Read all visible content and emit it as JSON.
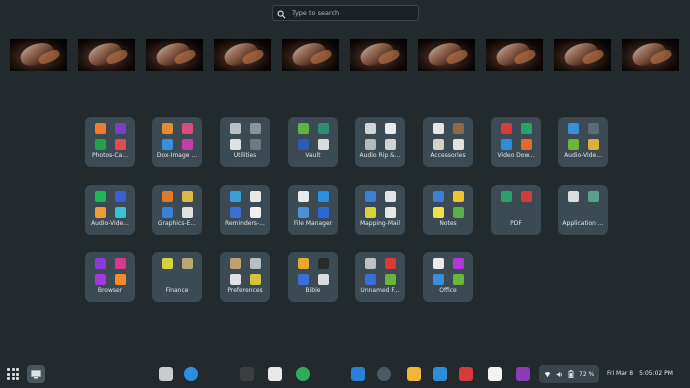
{
  "search": {
    "placeholder": "Type to search"
  },
  "workspaces": [
    "ws1",
    "ws2",
    "ws3",
    "ws4",
    "ws5",
    "ws6",
    "ws7",
    "ws8",
    "ws9",
    "ws10"
  ],
  "folders": [
    {
      "label": "Photos-Ca...",
      "icons": [
        "#f27b2c",
        "#7a3fc0",
        "#22a34a",
        "#e14d4d"
      ],
      "icon_names": [
        "photo-icon",
        "camera-icon",
        "gallery-icon",
        "image-viewer-icon"
      ]
    },
    {
      "label": "Dox-Image ...",
      "icons": [
        "#e58a32",
        "#d94d7c",
        "#3b8fd8",
        "#c53ea6"
      ],
      "icon_names": [
        "document-icon",
        "image-editor-icon",
        "scanner-icon",
        "viewer-icon"
      ]
    },
    {
      "label": "Utilities",
      "icons": [
        "#b9c0c4",
        "#8d9397",
        "#dfe3e6",
        "#6f7a80"
      ],
      "icon_names": [
        "monitor-icon",
        "disk-icon",
        "tool-icon",
        "terminal-icon"
      ]
    },
    {
      "label": "Vault",
      "icons": [
        "#5fb248",
        "#2f8f6f",
        "#2d5ab3",
        "#d8dcde"
      ],
      "icon_names": [
        "vault-icon",
        "lock-icon",
        "shield-icon",
        "key-icon"
      ]
    },
    {
      "label": "Audio Rip &...",
      "icons": [
        "#d1d5d8",
        "#e8eaeb",
        "#b3b9bc",
        "#cfd3d6"
      ],
      "icon_names": [
        "disc-icon",
        "cd-icon",
        "ripper-icon",
        "audio-icon"
      ]
    },
    {
      "label": "Accessories",
      "icons": [
        "#e6e6e6",
        "#8b6b4a",
        "#d6d0c6",
        "#e1e1e1"
      ],
      "icon_names": [
        "cup-icon",
        "coffee-icon",
        "notes-icon",
        "calc-icon"
      ]
    },
    {
      "label": "Video Dow...",
      "icons": [
        "#d93a3a",
        "#2aa36a",
        "#2a8fd6",
        "#e36a2a"
      ],
      "icon_names": [
        "video-download-icon",
        "tube-icon",
        "globe-icon",
        "down-icon"
      ]
    },
    {
      "label": "Audio-Vide...",
      "icons": [
        "#3a8fd8",
        "#5a6b74",
        "#6bb53a",
        "#d8b03a"
      ],
      "icon_names": [
        "player-icon",
        "camera-video-icon",
        "media-icon",
        "film-icon"
      ]
    },
    {
      "label": "Audio-Vide...",
      "icons": [
        "#1db954",
        "#3a5fd8",
        "#f29c38",
        "#3ac1d8"
      ],
      "icon_names": [
        "spotify-icon",
        "music-icon",
        "media-player-icon",
        "play-store-icon"
      ]
    },
    {
      "label": "Graphics-E...",
      "icons": [
        "#e07a2a",
        "#d8b94a",
        "#3a7fd8",
        "#e0e0e0"
      ],
      "icon_names": [
        "paint-icon",
        "draw-icon",
        "color-icon",
        "pen-icon"
      ]
    },
    {
      "label": "Reminders-...",
      "icons": [
        "#3a9fd8",
        "#e8e8e8",
        "#3a6fd8",
        "#f0f0f0"
      ],
      "icon_names": [
        "calendar-icon",
        "notes-icon",
        "clock-icon",
        "dot-icon"
      ]
    },
    {
      "label": "File Manager",
      "icons": [
        "#e8eaeb",
        "#2a8fe0",
        "#4a8fd8",
        "#2a6ad8"
      ],
      "icon_names": [
        "file-icon",
        "folder-icon",
        "drive-icon",
        "explorer-icon"
      ]
    },
    {
      "label": "Mapping-Mail",
      "icons": [
        "#3a7fd8",
        "#dfe3e6",
        "#d8d23a",
        "#e6e6e6"
      ],
      "icon_names": [
        "map-icon",
        "route-icon",
        "mail-icon",
        "pin-icon"
      ]
    },
    {
      "label": "Notes",
      "icons": [
        "#3a7fd8",
        "#f2c230",
        "#f2e04a",
        "#5ab048"
      ],
      "icon_names": [
        "notes-icon",
        "sticky-icon",
        "memo-icon",
        "list-icon"
      ]
    },
    {
      "label": "PDF",
      "icons": [
        "#2aa36a",
        "#d83a3a"
      ],
      "icon_names": [
        "pdf-viewer-icon",
        "pdf-icon"
      ]
    },
    {
      "label": "Application ...",
      "icons": [
        "#d9dde0",
        "#5aa08f"
      ],
      "icon_names": [
        "app-icon",
        "package-icon"
      ]
    },
    {
      "label": "Browser",
      "icons": [
        "#8b3ad8",
        "#d83a8b",
        "#a03ad8",
        "#f28c2a"
      ],
      "icon_names": [
        "tor-icon",
        "browser-icon",
        "vivaldi-icon",
        "firefox-icon"
      ]
    },
    {
      "label": "Finance",
      "icons": [
        "#d8d23a",
        "#b8a878"
      ],
      "icon_names": [
        "money-icon",
        "coins-icon"
      ]
    },
    {
      "label": "Preferences",
      "icons": [
        "#c0a070",
        "#b9bec1",
        "#dfe3e6",
        "#d8c23a"
      ],
      "icon_names": [
        "settings-icon",
        "config-icon",
        "tweaks-icon",
        "power-icon"
      ]
    },
    {
      "label": "Bible",
      "icons": [
        "#e8a92a",
        "#2a2a2a",
        "#3a6fd8",
        "#d8dcde"
      ],
      "icon_names": [
        "bible-icon",
        "book-icon",
        "cross-icon",
        "scroll-icon"
      ]
    },
    {
      "label": "Unnamed F...",
      "icons": [
        "#c0c0c0",
        "#d83a3a",
        "#3a6fd8",
        "#6bb53a"
      ],
      "icon_names": [
        "record-icon",
        "flag-icon",
        "app-a-icon",
        "app-b-icon"
      ]
    },
    {
      "label": "Office",
      "icons": [
        "#e8eaeb",
        "#b03ad8",
        "#3a8fd8",
        "#6bb53a"
      ],
      "icon_names": [
        "doc-icon",
        "slides-icon",
        "writer-icon",
        "calc-icon"
      ]
    }
  ],
  "dock": {
    "apps": [
      {
        "name": "text-editor-icon",
        "color": "#c9ccce"
      },
      {
        "name": "safari-icon",
        "color": "#2a8fe0"
      },
      {
        "name": "terminal-icon",
        "color": "#3b3f42"
      },
      {
        "name": "app-center-icon",
        "color": "#e8e8e8"
      },
      {
        "name": "pie-icon",
        "color": "#2fae5a"
      },
      {
        "name": "bluetooth-icon",
        "color": "#2a7fd8"
      },
      {
        "name": "system-monitor-icon",
        "color": "#4a5a64"
      },
      {
        "name": "shop-icon",
        "color": "#f2b43a"
      },
      {
        "name": "screenshot-icon",
        "color": "#2a8fd8"
      },
      {
        "name": "reader-icon",
        "color": "#d83a3a"
      },
      {
        "name": "settings-gear-icon",
        "color": "#f2f2f2"
      },
      {
        "name": "purple-app-icon",
        "color": "#8b3ab8"
      }
    ],
    "tray": {
      "battery": "72 %"
    },
    "clock": {
      "date": "Fri Mar 8",
      "time": "5:05:02 PM"
    }
  }
}
